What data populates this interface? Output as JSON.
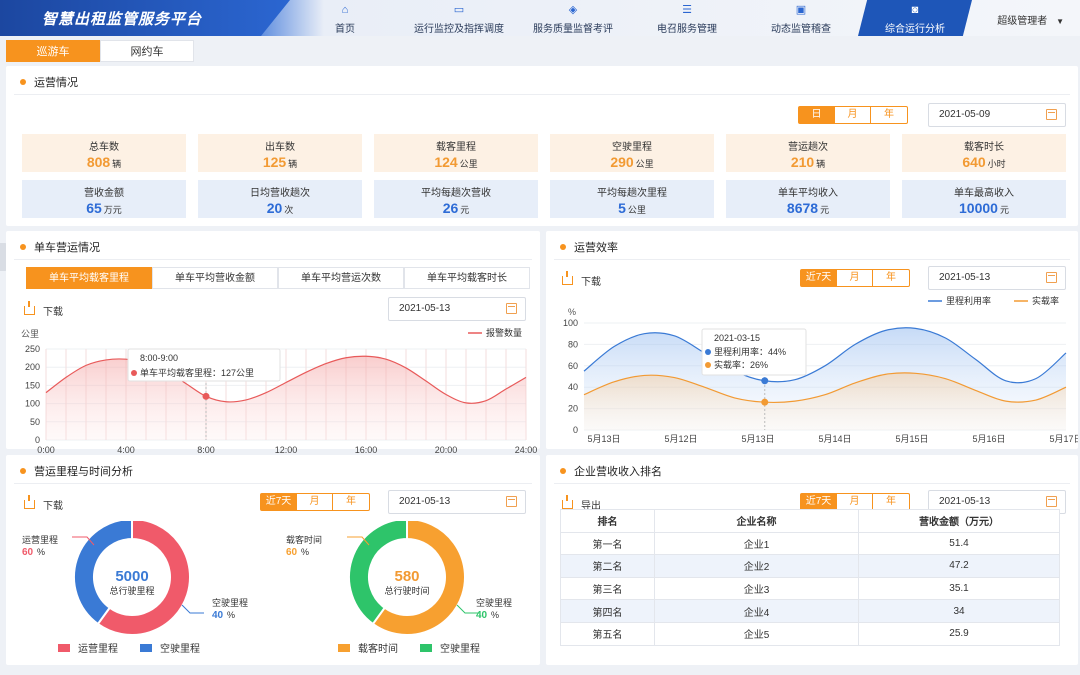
{
  "header": {
    "title": "智慧出租监管服务平台",
    "nav": [
      {
        "label": "首页",
        "icon": "home-icon",
        "glyph": "⌂"
      },
      {
        "label": "运行监控及指挥调度",
        "icon": "monitor-icon",
        "glyph": "▭"
      },
      {
        "label": "服务质量监督考评",
        "icon": "shield-icon",
        "glyph": "◈"
      },
      {
        "label": "电召服务管理",
        "icon": "list-icon",
        "glyph": "☰"
      },
      {
        "label": "动态监管稽查",
        "icon": "inspect-icon",
        "glyph": "▣"
      },
      {
        "label": "综合运行分析",
        "icon": "analysis-icon",
        "glyph": "◙",
        "active": true
      }
    ],
    "user": "超级管理者"
  },
  "subtabs": [
    {
      "label": "巡游车",
      "active": true
    },
    {
      "label": "网约车",
      "active": false
    }
  ],
  "ops": {
    "title": "运营情况",
    "periods": [
      "日",
      "月",
      "年"
    ],
    "active_period": "日",
    "date": "2021-05-09",
    "kpis_top": [
      {
        "label": "总车数",
        "value": "808",
        "unit": "辆"
      },
      {
        "label": "出车数",
        "value": "125",
        "unit": "辆"
      },
      {
        "label": "载客里程",
        "value": "124",
        "unit": "公里"
      },
      {
        "label": "空驶里程",
        "value": "290",
        "unit": "公里"
      },
      {
        "label": "营运趟次",
        "value": "210",
        "unit": "辆"
      },
      {
        "label": "载客时长",
        "value": "640",
        "unit": "小时"
      }
    ],
    "kpis_bottom": [
      {
        "label": "营收金额",
        "value": "65",
        "unit": "万元"
      },
      {
        "label": "日均营收趟次",
        "value": "20",
        "unit": "次"
      },
      {
        "label": "平均每趟次营收",
        "value": "26",
        "unit": "元"
      },
      {
        "label": "平均每趟次里程",
        "value": "5",
        "unit": "公里"
      },
      {
        "label": "单车平均收入",
        "value": "8678",
        "unit": "元"
      },
      {
        "label": "单车最高收入",
        "value": "10000",
        "unit": "元"
      }
    ]
  },
  "vehicle": {
    "title": "单车营运情况",
    "tabs": [
      "单车平均载客里程",
      "单车平均营收金额",
      "单车平均营运次数",
      "单车平均载客时长"
    ],
    "download": "下载",
    "date": "2021-05-13",
    "tooltip_time": "8:00-9:00",
    "tooltip_text": "单车平均载客里程：127公里"
  },
  "efficiency": {
    "title": "运营效率",
    "download": "下载",
    "periods": [
      "近7天",
      "月",
      "年"
    ],
    "date": "2021-05-13",
    "tooltip_date": "2021-03-15",
    "tooltip_a": "里程利用率：44%",
    "tooltip_b": "实载率：26%"
  },
  "mileage": {
    "title": "营运里程与时间分析",
    "download": "下载",
    "periods": [
      "近7天",
      "月",
      "年"
    ],
    "date": "2021-05-13",
    "donut1": {
      "center_value": "5000",
      "center_label": "总行驶里程",
      "a_label": "运营里程",
      "a_pct": "60",
      "b_label": "空驶里程",
      "b_pct": "40"
    },
    "donut2": {
      "center_value": "580",
      "center_label": "总行驶时间",
      "a_label": "载客时间",
      "a_pct": "60",
      "b_label": "空驶里程",
      "b_pct": "40"
    },
    "legend1": [
      "运营里程",
      "空驶里程"
    ],
    "legend2": [
      "载客时间",
      "空驶里程"
    ],
    "pct_sign": "%"
  },
  "revenue": {
    "title": "企业营收收入排名",
    "export": "导出",
    "periods": [
      "近7天",
      "月",
      "年"
    ],
    "date": "2021-05-13",
    "headers": [
      "排名",
      "企业名称",
      "营收金额（万元）"
    ],
    "rows": [
      [
        "第一名",
        "企业1",
        "51.4"
      ],
      [
        "第二名",
        "企业2",
        "47.2"
      ],
      [
        "第三名",
        "企业3",
        "35.1"
      ],
      [
        "第四名",
        "企业4",
        "34"
      ],
      [
        "第五名",
        "企业5",
        "25.9"
      ]
    ]
  },
  "chart_data": [
    {
      "type": "area",
      "ylabel": "公里",
      "ylim": [
        0,
        250
      ],
      "yticks": [
        0,
        50,
        100,
        150,
        200,
        250
      ],
      "xticks": [
        "0:00",
        "4:00",
        "8:00",
        "12:00",
        "16:00",
        "20:00",
        "24:00"
      ],
      "series": [
        {
          "name": "报警数量",
          "color": "#e85a5a",
          "x": [
            0,
            1,
            2,
            3,
            4,
            5,
            6,
            7,
            8,
            9,
            10,
            11,
            12,
            13,
            14,
            15,
            16,
            17,
            18,
            19,
            20,
            21,
            22,
            23,
            24
          ],
          "values": [
            130,
            172,
            205,
            220,
            222,
            212,
            190,
            155,
            120,
            105,
            110,
            130,
            158,
            186,
            210,
            226,
            230,
            222,
            198,
            162,
            125,
            102,
            108,
            140,
            172
          ]
        }
      ],
      "grid": true
    },
    {
      "type": "area",
      "ylabel": "%",
      "ylim": [
        0,
        100
      ],
      "yticks": [
        0,
        20,
        40,
        60,
        80,
        100
      ],
      "xticks": [
        "5月13日",
        "5月12日",
        "5月13日",
        "5月14日",
        "5月15日",
        "5月16日",
        "5月17日"
      ],
      "series": [
        {
          "name": "里程利用率",
          "color": "#3a7ad5",
          "values": [
            55,
            78,
            90,
            88,
            72,
            55,
            46,
            47,
            60,
            80,
            93,
            95,
            86,
            66,
            46,
            48,
            72
          ]
        },
        {
          "name": "实载率",
          "color": "#f29a33",
          "values": [
            33,
            45,
            51,
            49,
            40,
            30,
            26,
            27,
            33,
            44,
            52,
            53,
            48,
            37,
            27,
            28,
            40
          ]
        }
      ],
      "grid": true
    },
    {
      "type": "pie",
      "labels": [
        "运营里程",
        "空驶里程"
      ],
      "values": [
        60,
        40
      ],
      "colors": [
        "#f05a6a",
        "#3a7ad5"
      ]
    },
    {
      "type": "pie",
      "labels": [
        "载客时间",
        "空驶里程"
      ],
      "values": [
        60,
        40
      ],
      "colors": [
        "#f7a030",
        "#2ec46a"
      ]
    }
  ]
}
